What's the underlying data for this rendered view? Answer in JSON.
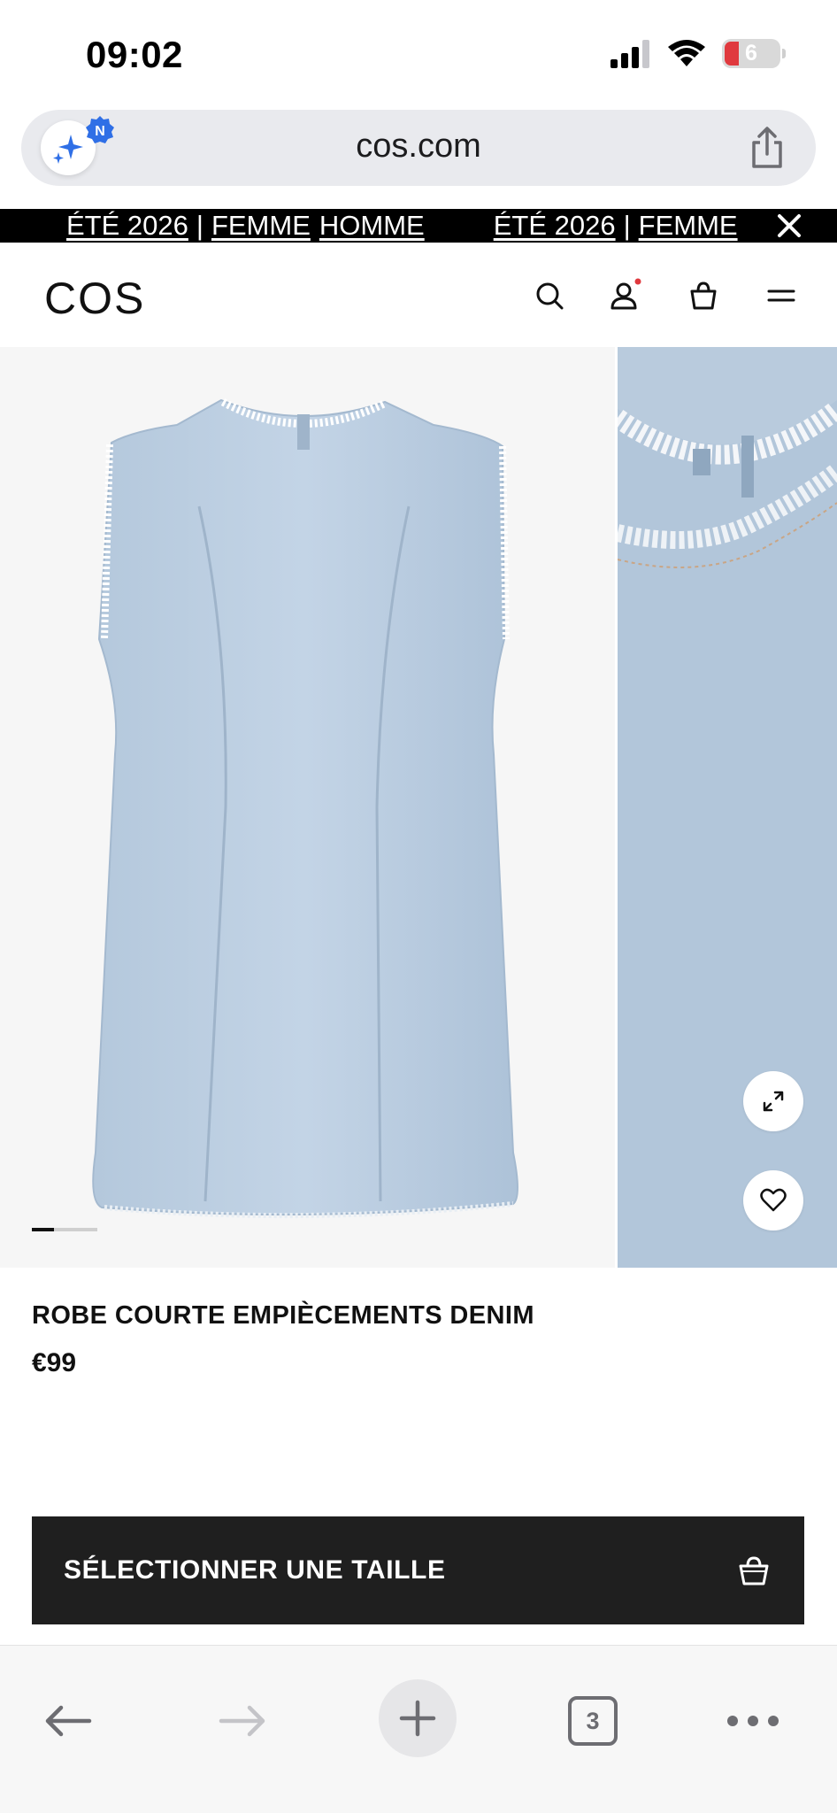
{
  "status_bar": {
    "time": "09:02",
    "battery_level": "6",
    "icons": [
      "cellular-signal-icon",
      "wifi-icon",
      "battery-icon"
    ]
  },
  "browser": {
    "url": "cos.com",
    "assistant_badge": "N",
    "icons": [
      "assistant-sparkle-icon",
      "share-icon"
    ]
  },
  "promo_banner": {
    "items": [
      {
        "season": "ÉTÉ 2026",
        "divider": "|",
        "women": "FEMME",
        "men": "HOMME"
      },
      {
        "season": "ÉTÉ 2026",
        "divider": "|",
        "women": "FEMME"
      }
    ],
    "close_icon": "close-icon"
  },
  "header": {
    "logo": "COS",
    "icons": [
      "search-icon",
      "account-icon",
      "bag-icon",
      "menu-icon"
    ]
  },
  "gallery": {
    "active_index": 0,
    "images": [
      "denim-dress-front",
      "denim-dress-neck-detail"
    ],
    "icons": [
      "expand-icon",
      "heart-icon"
    ]
  },
  "product": {
    "name": "ROBE COURTE EMPIÈCEMENTS DENIM",
    "price": "€99"
  },
  "cta": {
    "label": "SÉLECTIONNER UNE TAILLE",
    "icon": "bag-icon"
  },
  "toolbar": {
    "tabs_count": "3",
    "icons": [
      "back-icon",
      "forward-icon",
      "new-tab-icon",
      "tabs-icon",
      "more-icon"
    ]
  },
  "colors": {
    "promo_bg": "#000000",
    "cta_bg": "#1f1f1f",
    "denim": "#bdd0e2",
    "notification_dot": "#e0393e",
    "assistant_blue": "#2f6fe6"
  }
}
